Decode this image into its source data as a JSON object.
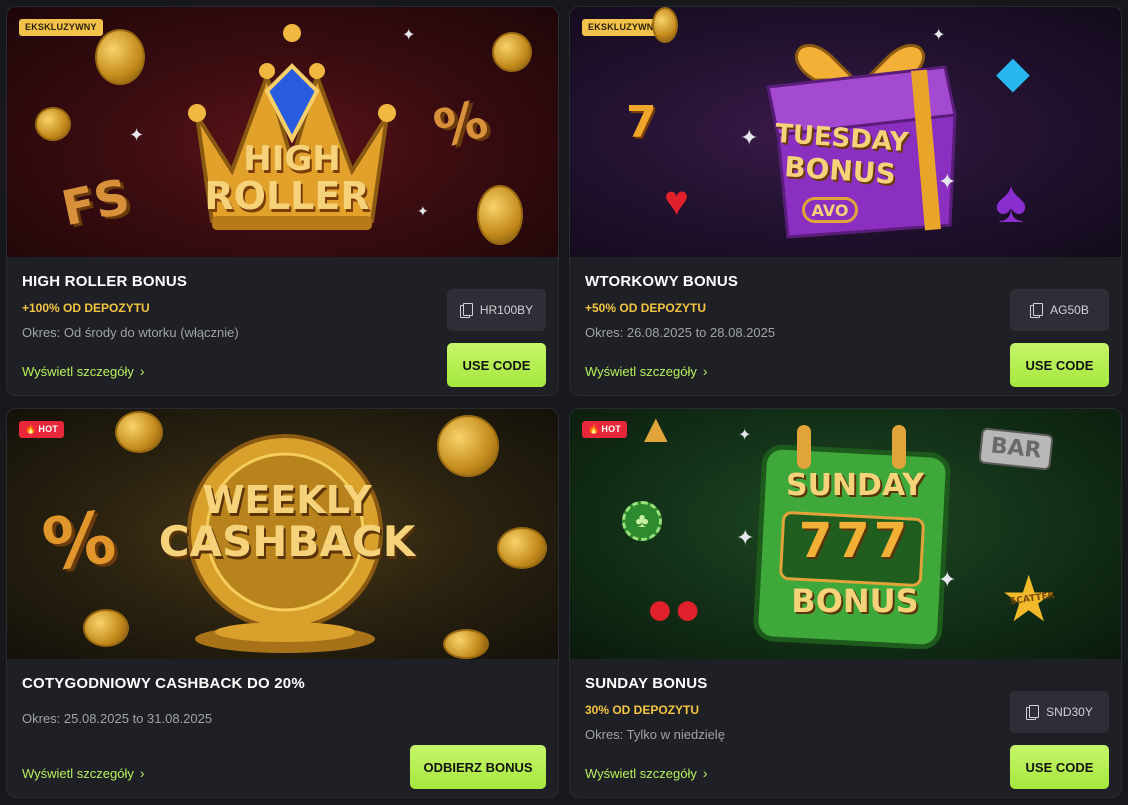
{
  "cards": [
    {
      "badge": "EKSKLUZYWNY",
      "banner_text": [
        "HIGH",
        "ROLLER"
      ],
      "banner_extras": {
        "left": "FS",
        "right": "%"
      },
      "title": "HIGH ROLLER BONUS",
      "subtitle": "+100% OD DEPOZYTU",
      "period": "Okres: Od środy do wtorku (włącznie)",
      "details_label": "Wyświetl szczegóły",
      "code": "HR100BY",
      "cta": "USE CODE"
    },
    {
      "badge": "EKSKLUZYWNY",
      "banner_text": [
        "TUESDAY",
        "BONUS"
      ],
      "banner_logo": "AVO",
      "banner_extras": {
        "left": "7"
      },
      "title": "WTORKOWY BONUS",
      "subtitle": "+50% OD DEPOZYTU",
      "period": "Okres: 26.08.2025 to 28.08.2025",
      "details_label": "Wyświetl szczegóły",
      "code": "AG50B",
      "cta": "USE CODE"
    },
    {
      "badge": "HOT",
      "banner_text": [
        "WEEKLY",
        "CASHBACK"
      ],
      "banner_extras": {
        "left": "%"
      },
      "title": "COTYGODNIOWY CASHBACK DO 20%",
      "period": "Okres: 25.08.2025 to 31.08.2025",
      "details_label": "Wyświetl szczegóły",
      "cta": "ODBIERZ BONUS"
    },
    {
      "badge": "HOT",
      "banner_text": [
        "SUNDAY",
        "777",
        "BONUS"
      ],
      "banner_extras": {
        "bar": "BAR",
        "scatter": "SCATTER"
      },
      "title": "SUNDAY BONUS",
      "subtitle": "30% OD DEPOZYTU",
      "period": "Okres: Tylko w niedzielę",
      "details_label": "Wyświetl szczegóły",
      "code": "SND30Y",
      "cta": "USE CODE"
    }
  ],
  "colors": {
    "accent_green": "#b5f05a",
    "cta_green": "#a6e83e",
    "subtitle_gold": "#f4c542",
    "badge_exclusive": "#f2c24a",
    "badge_hot": "#e8283a"
  }
}
